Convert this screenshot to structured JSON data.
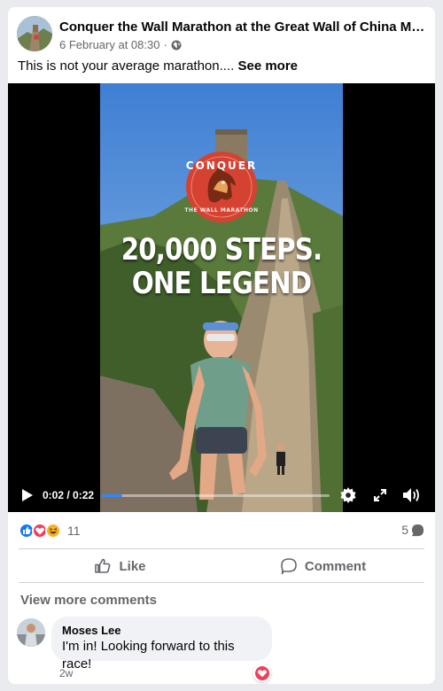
{
  "post": {
    "page_name": "Conquer the Wall Marathon at the Great Wall of China Marat...",
    "date": "6 February at 08:30",
    "separator": "·",
    "privacy_icon": "globe-icon",
    "caption": "This is not your average marathon....",
    "see_more": "See more"
  },
  "video": {
    "logo_text_top": "CONQUER",
    "logo_text_bottom": "THE WALL MARATHON",
    "headline_line1": "20,000 STEPS.",
    "headline_line2": "ONE LEGEND",
    "time": "0:02 / 0:22",
    "progress": 0.09,
    "icons": [
      "play-icon",
      "settings-icon",
      "fullscreen-icon",
      "volume-icon"
    ]
  },
  "stats": {
    "reaction_icons": [
      "like-icon",
      "love-icon",
      "haha-icon"
    ],
    "reaction_count": "11",
    "comment_count": "5"
  },
  "actions": {
    "like": "Like",
    "comment": "Comment"
  },
  "comments": {
    "view_more": "View more comments",
    "items": [
      {
        "author": "Moses Lee",
        "text": "I'm in! Looking forward to this race!",
        "time": "2w",
        "reaction": "love-icon"
      }
    ]
  },
  "colors": {
    "accent": "#2d88ff",
    "love": "#f33e58",
    "haha": "#f7b125",
    "text_secondary": "#65676b"
  }
}
